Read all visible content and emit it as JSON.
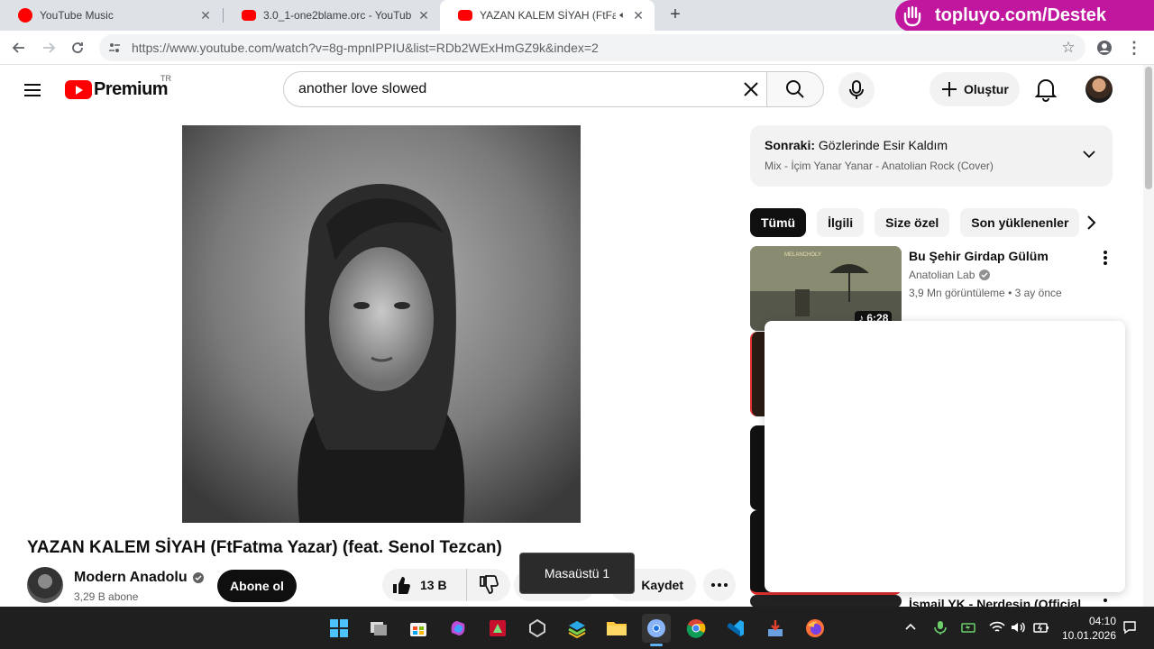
{
  "browser": {
    "tabs": [
      {
        "title": "YouTube Music",
        "active": false
      },
      {
        "title": "3.0_1-one2blame.orc - YouTube",
        "active": false
      },
      {
        "title": "YAZAN KALEM SİYAH (FtFatma",
        "active": true
      }
    ],
    "url": "https://www.youtube.com/watch?v=8g-mpnIPPIU&list=RDb2WExHmGZ9k&index=2",
    "promo": "topluyo.com/Destek"
  },
  "header": {
    "logo_text": "Premium",
    "country_code": "TR",
    "search_value": "another love slowed",
    "create_label": "Oluştur"
  },
  "video": {
    "title": "YAZAN KALEM SİYAH (FtFatma Yazar) (feat. Senol Tezcan)",
    "channel": "Modern Anadolu",
    "subscribers": "3,29 B abone",
    "subscribe_label": "Abone ol",
    "likes": "13 B",
    "save_label": "Kaydet",
    "tooltip": "Masaüstü 1"
  },
  "up_next": {
    "prefix": "Sonraki:",
    "title": "Gözlerinde Esir Kaldım",
    "subtitle": "Mix - İçim Yanar Yanar - Anatolian Rock (Cover)"
  },
  "chips": [
    "Tümü",
    "İlgili",
    "Size özel",
    "Son yüklenenler"
  ],
  "recommendations": [
    {
      "title": "Bu Şehir Girdap Gülüm",
      "channel": "Anatolian Lab",
      "views": "3,9 Mn görüntüleme",
      "age": "3 ay önce",
      "duration": "6:28",
      "thumb_text": "MELANCHOLY"
    },
    {
      "title": "İsmail YK - Nerdesin (Official"
    }
  ],
  "taskbar": {
    "time": "04:10",
    "date": "10.01.2026"
  },
  "colors": {
    "youtube_red": "#ff0000",
    "promo_magenta": "#c0179e",
    "taskbar_bg": "#1f1f1f"
  }
}
